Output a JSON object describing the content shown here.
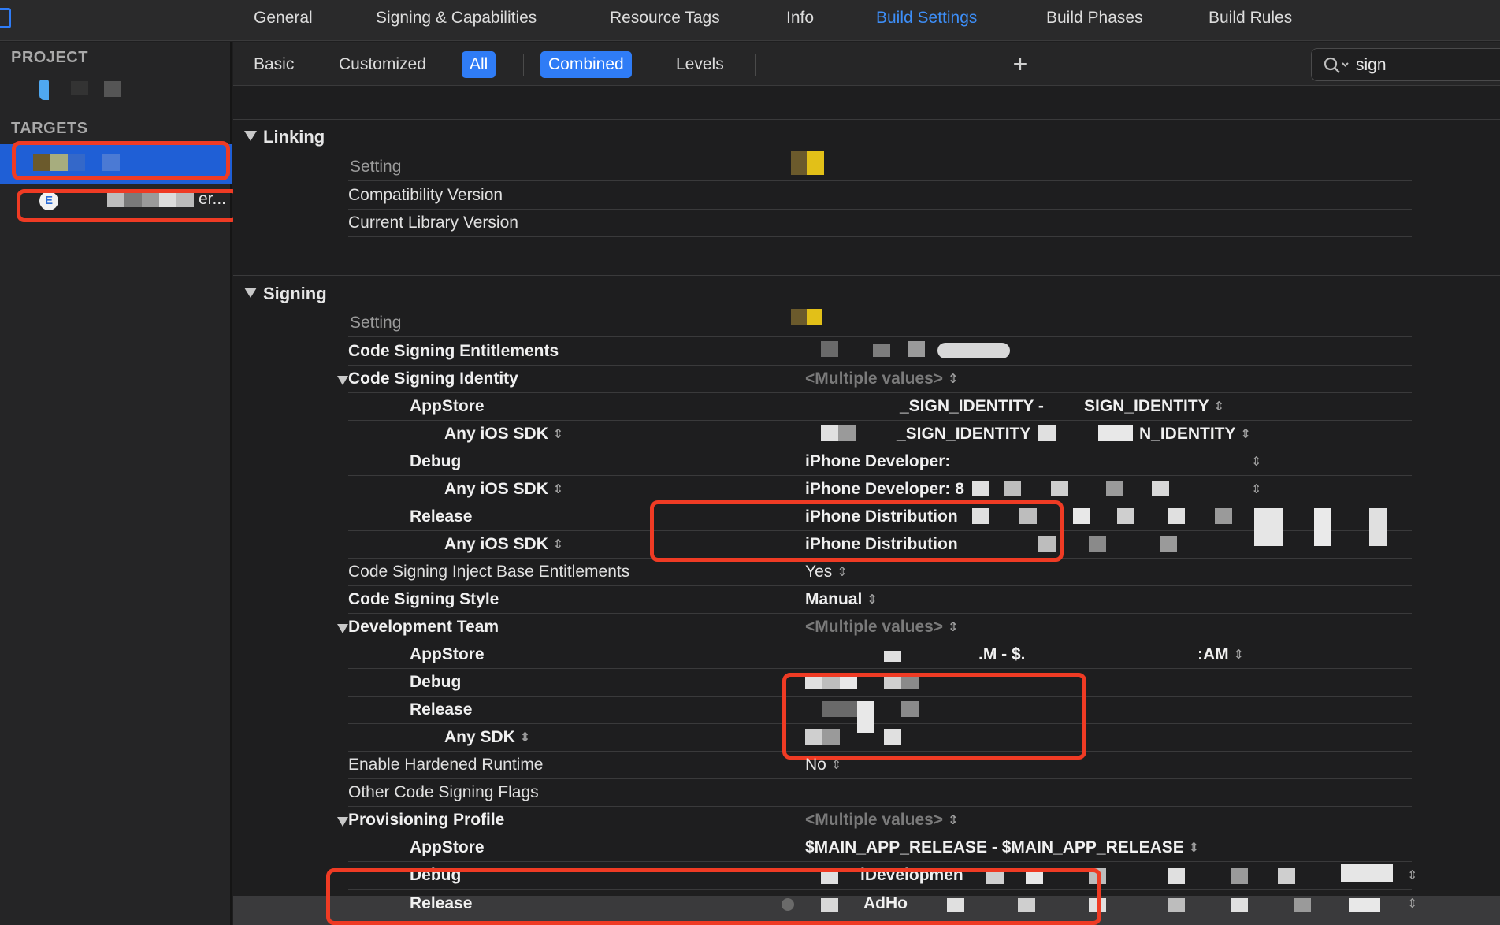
{
  "tabs": [
    {
      "label": "General",
      "active": false
    },
    {
      "label": "Signing & Capabilities",
      "active": false
    },
    {
      "label": "Resource Tags",
      "active": false
    },
    {
      "label": "Info",
      "active": false
    },
    {
      "label": "Build Settings",
      "active": true
    },
    {
      "label": "Build Phases",
      "active": false
    },
    {
      "label": "Build Rules",
      "active": false
    }
  ],
  "sidebar": {
    "project_heading": "PROJECT",
    "targets_heading": "TARGETS",
    "second_target_suffix": "er..."
  },
  "filters": {
    "basic": "Basic",
    "customized": "Customized",
    "all": "All",
    "combined": "Combined",
    "levels": "Levels",
    "add": "+"
  },
  "search": {
    "value": "sign"
  },
  "linking": {
    "title": "Linking",
    "header": "Setting",
    "rows": [
      "Compatibility Version",
      "Current Library Version"
    ]
  },
  "signing": {
    "title": "Signing",
    "header": "Setting",
    "entitlements": {
      "name": "Code Signing Entitlements"
    },
    "identity": {
      "name": "Code Signing Identity",
      "value": "<Multiple values>",
      "appstore": {
        "name": "AppStore",
        "value_a": "_SIGN_IDENTITY  -",
        "value_b": "SIGN_IDENTITY"
      },
      "appstore_sdk": {
        "name": "Any iOS SDK",
        "value_a": "_SIGN_IDENTITY",
        "value_b": "N_IDENTITY"
      },
      "debug": {
        "name": "Debug",
        "value": "iPhone Developer:"
      },
      "debug_sdk": {
        "name": "Any iOS SDK",
        "value": "iPhone Developer: 8"
      },
      "release": {
        "name": "Release",
        "value": "iPhone Distribution"
      },
      "release_sdk": {
        "name": "Any iOS SDK",
        "value": "iPhone Distribution"
      }
    },
    "inject": {
      "name": "Code Signing Inject Base Entitlements",
      "value": "Yes"
    },
    "style": {
      "name": "Code Signing Style",
      "value": "Manual"
    },
    "team": {
      "name": "Development Team",
      "value": "<Multiple values>",
      "appstore": {
        "name": "AppStore",
        "value_a": ".M  -  $.",
        "value_b": ":AM"
      },
      "debug": {
        "name": "Debug"
      },
      "release": {
        "name": "Release"
      },
      "release_sdk": {
        "name": "Any SDK"
      }
    },
    "hardened": {
      "name": "Enable Hardened Runtime",
      "value": "No"
    },
    "other_flags": {
      "name": "Other Code Signing Flags"
    },
    "profile": {
      "name": "Provisioning Profile",
      "value": "<Multiple values>",
      "appstore": {
        "name": "AppStore",
        "value": "$MAIN_APP_RELEASE  -  $MAIN_APP_RELEASE"
      },
      "debug": {
        "name": "Debug",
        "value": "lDevelopmen"
      },
      "release": {
        "name": "Release",
        "value": "AdHo"
      }
    }
  },
  "stepper_glyph": "⇕",
  "colors": {
    "accent": "#2f7cf6",
    "annotation": "#ef3b24",
    "selection": "#1f5fd6"
  }
}
